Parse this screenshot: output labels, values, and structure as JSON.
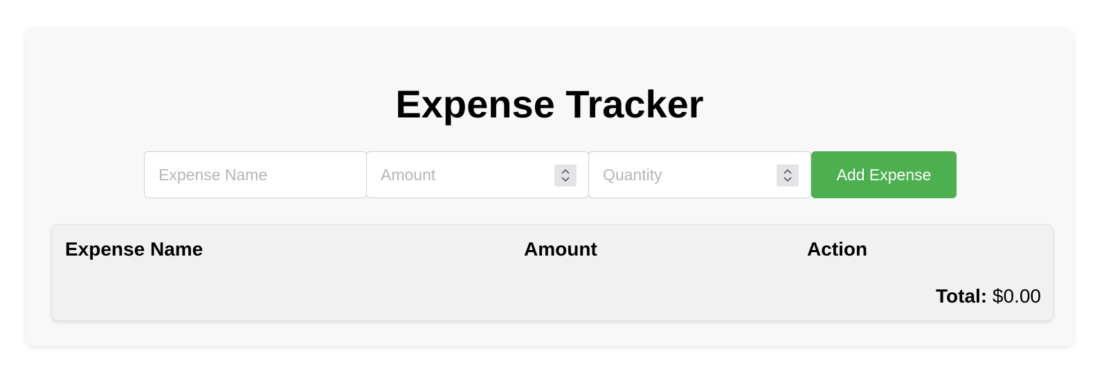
{
  "header": {
    "title": "Expense Tracker"
  },
  "form": {
    "name_placeholder": "Expense Name",
    "amount_placeholder": "Amount",
    "quantity_placeholder": "Quantity",
    "add_button_label": "Add Expense",
    "accent_color": "#4caf50"
  },
  "table": {
    "columns": [
      "Expense Name",
      "Amount",
      "Action"
    ],
    "rows": [],
    "total_label": "Total:",
    "total_value": "$0.00"
  }
}
